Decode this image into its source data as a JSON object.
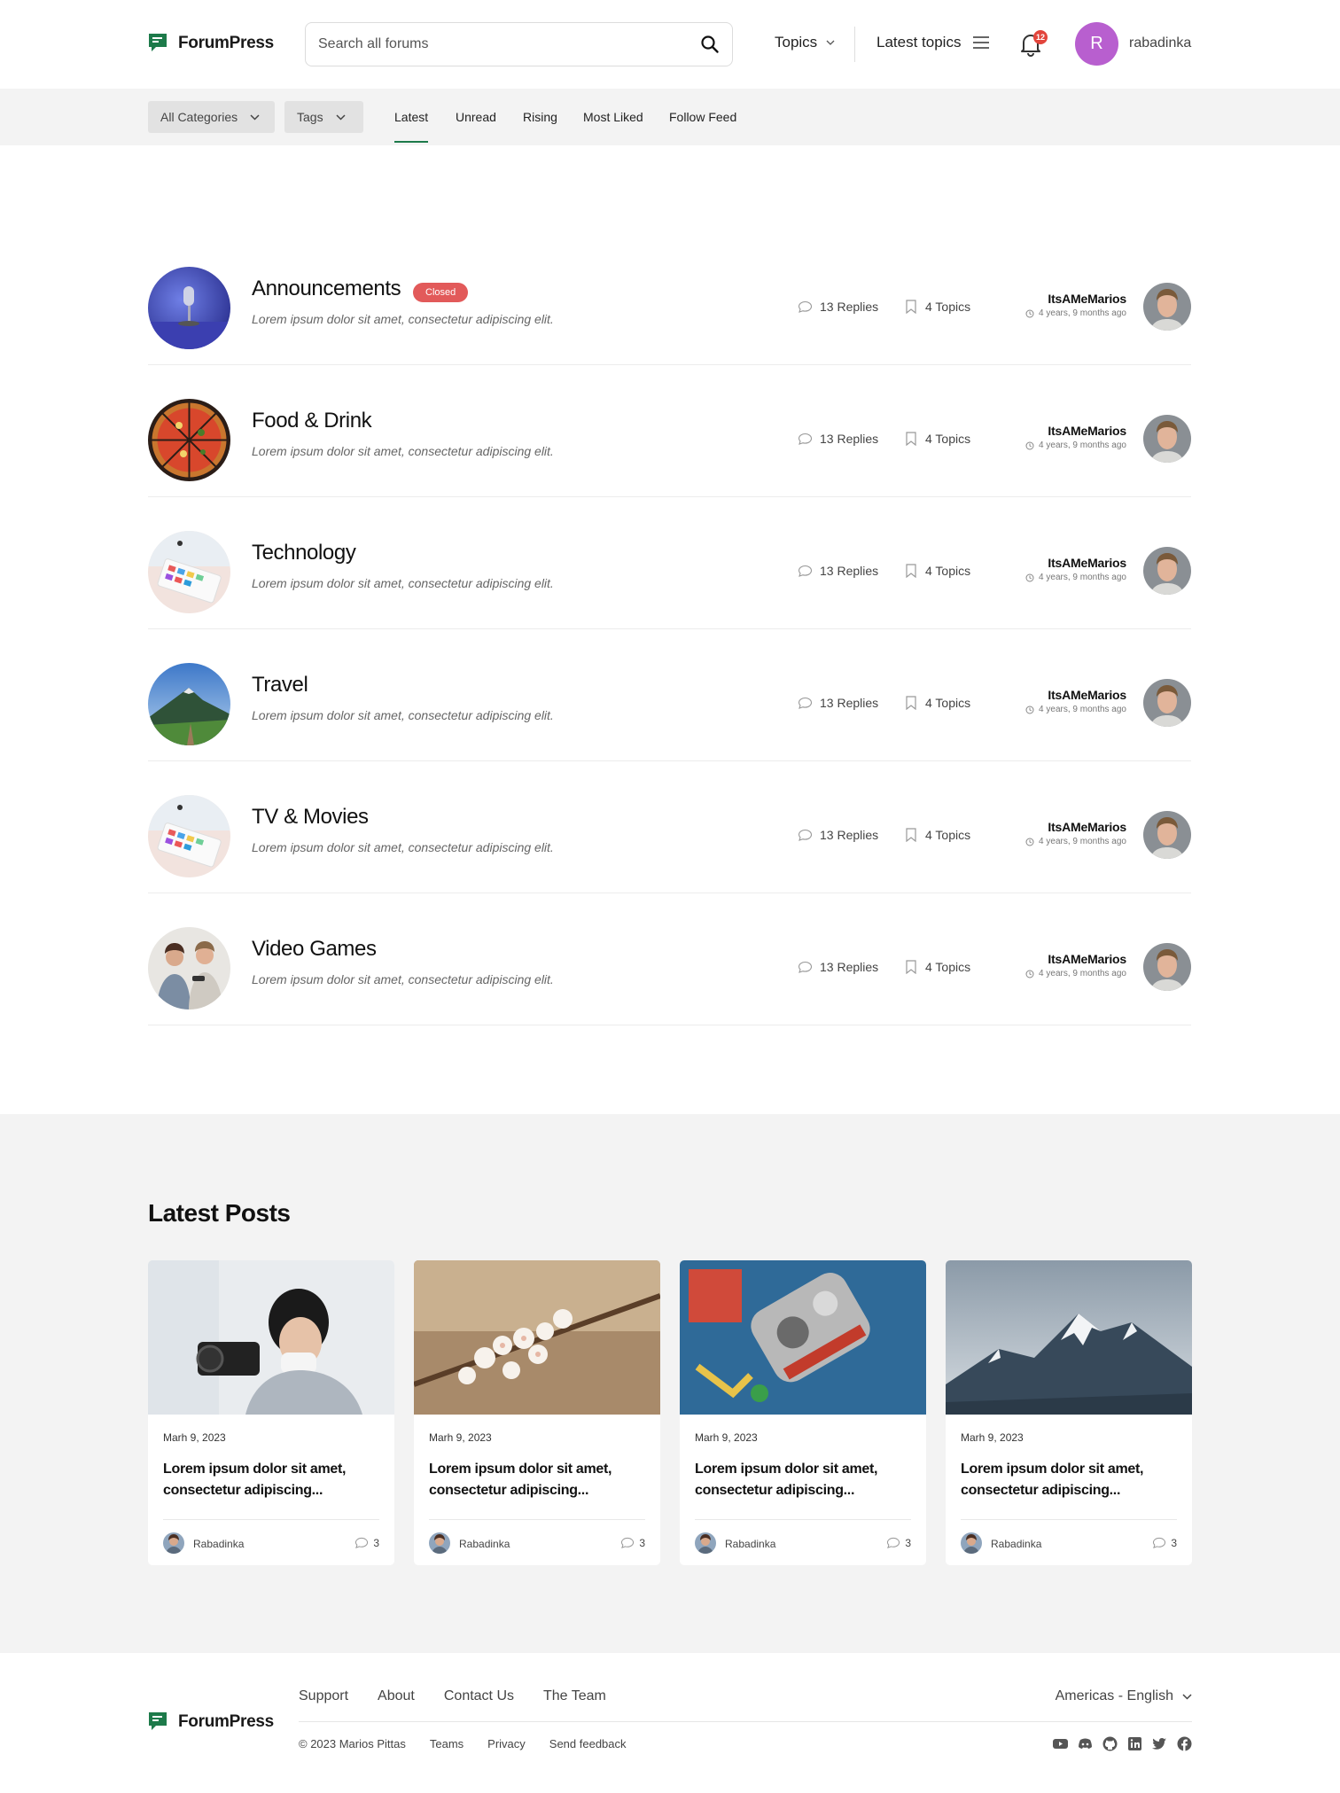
{
  "brand": {
    "name": "ForumPress",
    "color": "#1d7a4a"
  },
  "header": {
    "search_placeholder": "Search all forums",
    "topics_label": "Topics",
    "latest_topics_label": "Latest topics",
    "notification_count": "12",
    "user_initial": "R",
    "user_name": "rabadinka",
    "icons": {
      "search": "search-icon",
      "menu": "hamburger-icon",
      "bell": "bell-icon"
    }
  },
  "filters": {
    "categories_label": "All Categories",
    "tags_label": "Tags",
    "tabs": [
      "Latest",
      "Unread",
      "Rising",
      "Most Liked",
      "Follow Feed"
    ],
    "active_tab": "Latest"
  },
  "forums": [
    {
      "title": "Announcements",
      "badge": "Closed",
      "desc": "Lorem ipsum dolor sit amet, consectetur adipiscing elit.",
      "replies": "13 Replies",
      "topics": "4 Topics",
      "user": "ItsAMeMarios",
      "time": "4 years, 9 months ago"
    },
    {
      "title": "Food & Drink",
      "badge": "",
      "desc": "Lorem ipsum dolor sit amet, consectetur adipiscing elit.",
      "replies": "13 Replies",
      "topics": "4 Topics",
      "user": "ItsAMeMarios",
      "time": "4 years, 9 months ago"
    },
    {
      "title": "Technology",
      "badge": "",
      "desc": "Lorem ipsum dolor sit amet, consectetur adipiscing elit.",
      "replies": "13 Replies",
      "topics": "4 Topics",
      "user": "ItsAMeMarios",
      "time": "4 years, 9 months ago"
    },
    {
      "title": "Travel",
      "badge": "",
      "desc": "Lorem ipsum dolor sit amet, consectetur adipiscing elit.",
      "replies": "13 Replies",
      "topics": "4 Topics",
      "user": "ItsAMeMarios",
      "time": "4 years, 9 months ago"
    },
    {
      "title": "TV & Movies",
      "badge": "",
      "desc": "Lorem ipsum dolor sit amet, consectetur adipiscing elit.",
      "replies": "13 Replies",
      "topics": "4 Topics",
      "user": "ItsAMeMarios",
      "time": "4 years, 9 months ago"
    },
    {
      "title": "Video Games",
      "badge": "",
      "desc": "Lorem ipsum dolor sit amet, consectetur adipiscing elit.",
      "replies": "13 Replies",
      "topics": "4 Topics",
      "user": "ItsAMeMarios",
      "time": "4 years, 9 months ago"
    }
  ],
  "latest_posts": {
    "title": "Latest Posts",
    "posts": [
      {
        "date": "Marh 9, 2023",
        "title": "Lorem ipsum dolor sit amet, consectetur adipiscing...",
        "author": "Rabadinka",
        "comments": "3"
      },
      {
        "date": "Marh 9, 2023",
        "title": "Lorem ipsum dolor sit amet, consectetur adipiscing...",
        "author": "Rabadinka",
        "comments": "3"
      },
      {
        "date": "Marh 9, 2023",
        "title": "Lorem ipsum dolor sit amet, consectetur adipiscing...",
        "author": "Rabadinka",
        "comments": "3"
      },
      {
        "date": "Marh 9, 2023",
        "title": "Lorem ipsum dolor sit amet, consectetur adipiscing...",
        "author": "Rabadinka",
        "comments": "3"
      }
    ]
  },
  "footer": {
    "links": [
      "Support",
      "About",
      "Contact Us",
      "The Team"
    ],
    "copyright": "© 2023 Marios Pittas",
    "bottom_links": [
      "Teams",
      "Privacy",
      "Send feedback"
    ],
    "language": "Americas - English",
    "social_icons": [
      "youtube-icon",
      "discord-icon",
      "github-icon",
      "linkedin-icon",
      "twitter-icon",
      "facebook-icon"
    ]
  }
}
